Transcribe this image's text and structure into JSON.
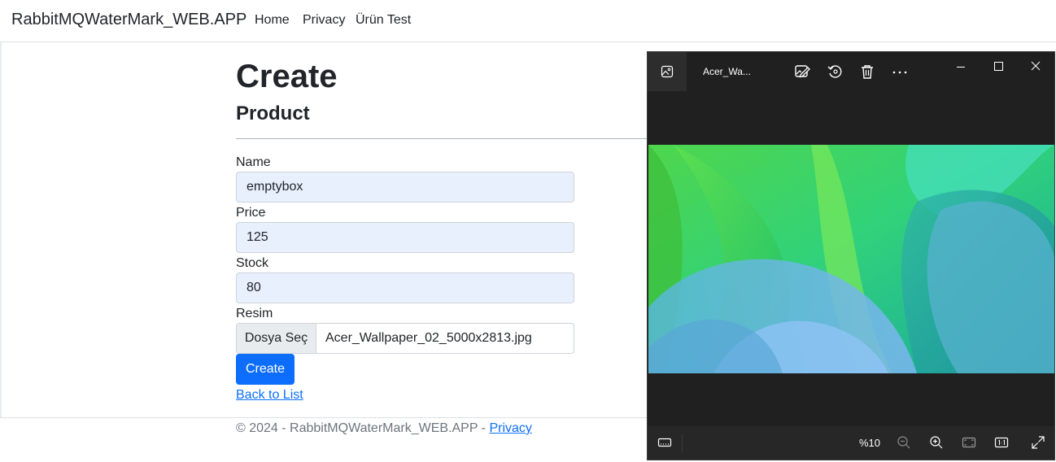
{
  "navbar": {
    "brand": "RabbitMQWaterMark_WEB.APP",
    "links": [
      "Home",
      "Privacy",
      "Ürün Test"
    ]
  },
  "page": {
    "title": "Create",
    "subtitle": "Product"
  },
  "form": {
    "name_label": "Name",
    "name_value": "emptybox",
    "price_label": "Price",
    "price_value": "125",
    "stock_label": "Stock",
    "stock_value": "80",
    "image_label": "Resim",
    "file_button": "Dosya Seç",
    "file_name": "Acer_Wallpaper_02_5000x2813.jpg",
    "submit_label": "Create"
  },
  "back_link": "Back to List",
  "footer": {
    "text": "© 2024 - RabbitMQWaterMark_WEB.APP - ",
    "link": "Privacy"
  },
  "viewer": {
    "title": "Acer_Wa...",
    "zoom": "%10",
    "toolbar_icons": [
      "edit-image-icon",
      "rotate-icon",
      "delete-icon",
      "more-icon"
    ],
    "window_controls": [
      "minimize-icon",
      "maximize-icon",
      "close-icon"
    ],
    "bottom_icons": [
      "filmstrip-icon",
      "zoom-out-icon",
      "zoom-in-icon",
      "fit-window-icon",
      "actual-size-icon",
      "fullscreen-icon"
    ]
  },
  "colors": {
    "primary": "#0d6efd",
    "autofill_bg": "#e8f0fe",
    "viewer_bg": "#202020",
    "wallpaper_green": "#3ddc5a",
    "wallpaper_teal": "#1fb8a6",
    "wallpaper_blue": "#6fb0e8"
  }
}
